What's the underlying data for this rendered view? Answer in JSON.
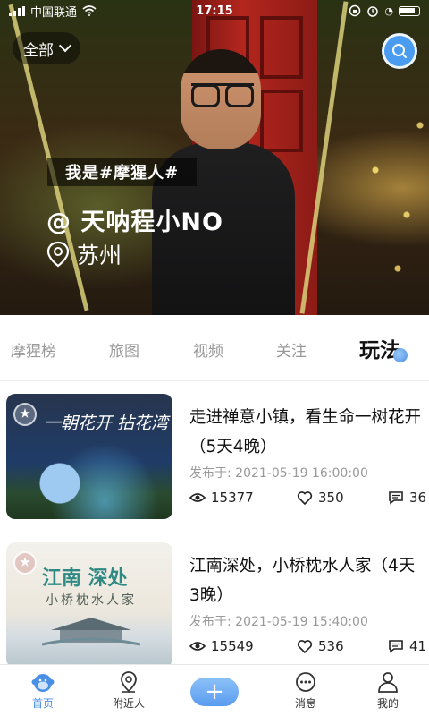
{
  "status_bar": {
    "carrier": "中国联通",
    "time": "17:15"
  },
  "hero": {
    "filter_label": "全部",
    "tag": "我是#摩猩人#",
    "user_name": "@ 天呐程小NO",
    "location": "苏州"
  },
  "tabs": [
    {
      "label": "摩猩榜"
    },
    {
      "label": "旅图"
    },
    {
      "label": "视频"
    },
    {
      "label": "关注"
    },
    {
      "label": "玩法",
      "active": true
    }
  ],
  "posts": [
    {
      "thumb_title": "一朝花开 拈花湾",
      "thumb_subtitle": "",
      "title": "走进禅意小镇，看生命一树花开（5天4晚）",
      "date": "发布于: 2021-05-19 16:00:00",
      "views": "15377",
      "likes": "350",
      "comments": "36"
    },
    {
      "thumb_title": "江南 深处",
      "thumb_subtitle": "小桥枕水人家",
      "title": "江南深处，小桥枕水人家（4天3晚）",
      "date": "发布于: 2021-05-19 15:40:00",
      "views": "15549",
      "likes": "536",
      "comments": "41"
    }
  ],
  "bottom_nav": [
    {
      "label": "首页",
      "icon": "home-monkey-icon",
      "active": true
    },
    {
      "label": "附近人",
      "icon": "location-pin-icon"
    },
    {
      "label": "",
      "icon": "plus-icon"
    },
    {
      "label": "消息",
      "icon": "message-icon"
    },
    {
      "label": "我的",
      "icon": "user-icon"
    }
  ],
  "colors": {
    "accent": "#4a8fe6",
    "text": "#111111",
    "muted": "#999999"
  }
}
